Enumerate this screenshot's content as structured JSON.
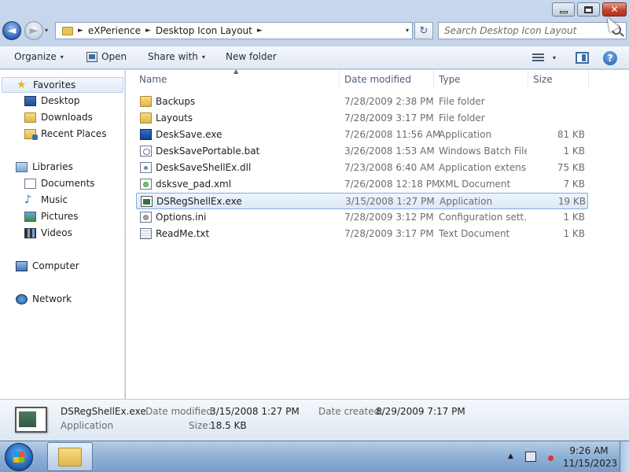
{
  "window": {
    "buttons": {
      "minimize_icon": "minimize-icon",
      "maximize_icon": "restore-icon",
      "close_label": "✕"
    }
  },
  "address": {
    "back_glyph": "◄",
    "forward_glyph": "►",
    "history_glyph": "▾",
    "crumbs": [
      "eXPerience",
      "Desktop Icon Layout"
    ],
    "separator": "►",
    "dropdown_glyph": "▾",
    "refresh_glyph": "↻"
  },
  "search": {
    "placeholder": "Search Desktop Icon Layout"
  },
  "commands": {
    "organize": "Organize",
    "open": "Open",
    "share_with": "Share with",
    "new_folder": "New folder",
    "caret": "▾",
    "help": "?"
  },
  "nav": {
    "favorites": "Favorites",
    "desktop": "Desktop",
    "downloads": "Downloads",
    "recent_places": "Recent Places",
    "libraries": "Libraries",
    "documents": "Documents",
    "music": "Music",
    "pictures": "Pictures",
    "videos": "Videos",
    "computer": "Computer",
    "network": "Network",
    "star_glyph": "★",
    "music_glyph": "♪"
  },
  "columns": {
    "name": "Name",
    "date_modified": "Date modified",
    "type": "Type",
    "size": "Size",
    "sort_glyph": "▲"
  },
  "files": [
    {
      "name": "Backups",
      "date": "7/28/2009 2:38 PM",
      "type": "File folder",
      "size": "",
      "icon": "folder-icon"
    },
    {
      "name": "Layouts",
      "date": "7/28/2009 3:17 PM",
      "type": "File folder",
      "size": "",
      "icon": "folder-icon"
    },
    {
      "name": "DeskSave.exe",
      "date": "7/26/2008 11:56 AM",
      "type": "Application",
      "size": "81 KB",
      "icon": "application-icon"
    },
    {
      "name": "DeskSavePortable.bat",
      "date": "3/26/2008 1:53 AM",
      "type": "Windows Batch File",
      "size": "1 KB",
      "icon": "batch-file-icon"
    },
    {
      "name": "DeskSaveShellEx.dll",
      "date": "7/23/2008 6:40 AM",
      "type": "Application extens...",
      "size": "75 KB",
      "icon": "dll-icon"
    },
    {
      "name": "dsksve_pad.xml",
      "date": "7/26/2008 12:18 PM",
      "type": "XML Document",
      "size": "7 KB",
      "icon": "xml-icon"
    },
    {
      "name": "DSRegShellEx.exe",
      "date": "3/15/2008 1:27 PM",
      "type": "Application",
      "size": "19 KB",
      "icon": "exe-icon"
    },
    {
      "name": "Options.ini",
      "date": "7/28/2009 3:12 PM",
      "type": "Configuration sett...",
      "size": "1 KB",
      "icon": "ini-icon"
    },
    {
      "name": "ReadMe.txt",
      "date": "7/28/2009 3:17 PM",
      "type": "Text Document",
      "size": "1 KB",
      "icon": "text-file-icon"
    }
  ],
  "details": {
    "file_name": "DSRegShellEx.exe",
    "file_type": "Application",
    "date_modified_label": "Date modified:",
    "date_modified": "3/15/2008 1:27 PM",
    "size_label": "Size:",
    "size": "18.5 KB",
    "date_created_label": "Date created:",
    "date_created": "8/29/2009 7:17 PM"
  },
  "taskbar": {
    "tray_arrow": "▲",
    "time": "9:26 AM",
    "date": "11/15/2023"
  },
  "colors": {
    "selection_border": "#84acdd",
    "close_button": "#c2452c",
    "folder": "#e0b64a"
  }
}
